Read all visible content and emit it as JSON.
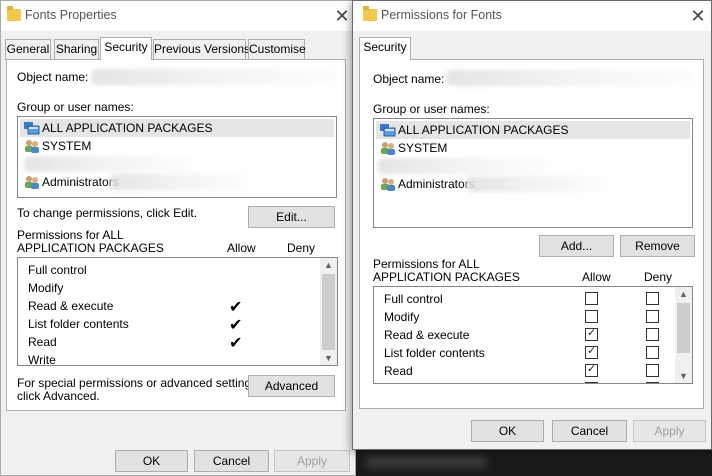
{
  "win1": {
    "title": "Fonts Properties",
    "close": "✕",
    "tabs": [
      "General",
      "Sharing",
      "Security",
      "Previous Versions",
      "Customise"
    ],
    "object_name_label": "Object name:",
    "group_label": "Group or user names:",
    "users": [
      "ALL APPLICATION PACKAGES",
      "SYSTEM",
      "Administrators"
    ],
    "change_text": "To change permissions, click Edit.",
    "edit_button": "Edit...",
    "perm_label_1": "Permissions for ALL",
    "perm_label_2": "APPLICATION PACKAGES",
    "allow": "Allow",
    "deny": "Deny",
    "permissions": [
      {
        "name": "Full control",
        "allow": false
      },
      {
        "name": "Modify",
        "allow": false
      },
      {
        "name": "Read & execute",
        "allow": true
      },
      {
        "name": "List folder contents",
        "allow": true
      },
      {
        "name": "Read",
        "allow": true
      },
      {
        "name": "Write",
        "allow": false
      }
    ],
    "tick": "✔",
    "special_1": "For special permissions or advanced settings,",
    "special_2": "click Advanced.",
    "advanced_button": "Advanced",
    "ok": "OK",
    "cancel": "Cancel",
    "apply": "Apply"
  },
  "win2": {
    "title": "Permissions for Fonts",
    "close": "✕",
    "tab": "Security",
    "object_name_label": "Object name:",
    "group_label": "Group or user names:",
    "users": [
      "ALL APPLICATION PACKAGES",
      "SYSTEM",
      "Administrators"
    ],
    "add_button": "Add...",
    "remove_button": "Remove",
    "perm_label_1": "Permissions for ALL",
    "perm_label_2": "APPLICATION PACKAGES",
    "allow": "Allow",
    "deny": "Deny",
    "permissions": [
      {
        "name": "Full control",
        "allow": false,
        "deny": false
      },
      {
        "name": "Modify",
        "allow": false,
        "deny": false
      },
      {
        "name": "Read & execute",
        "allow": true,
        "deny": false
      },
      {
        "name": "List folder contents",
        "allow": true,
        "deny": false
      },
      {
        "name": "Read",
        "allow": true,
        "deny": false
      }
    ],
    "check_glyph": "✓",
    "ok": "OK",
    "cancel": "Cancel",
    "apply": "Apply"
  },
  "scroll": {
    "up": "▲",
    "down": "▼"
  }
}
